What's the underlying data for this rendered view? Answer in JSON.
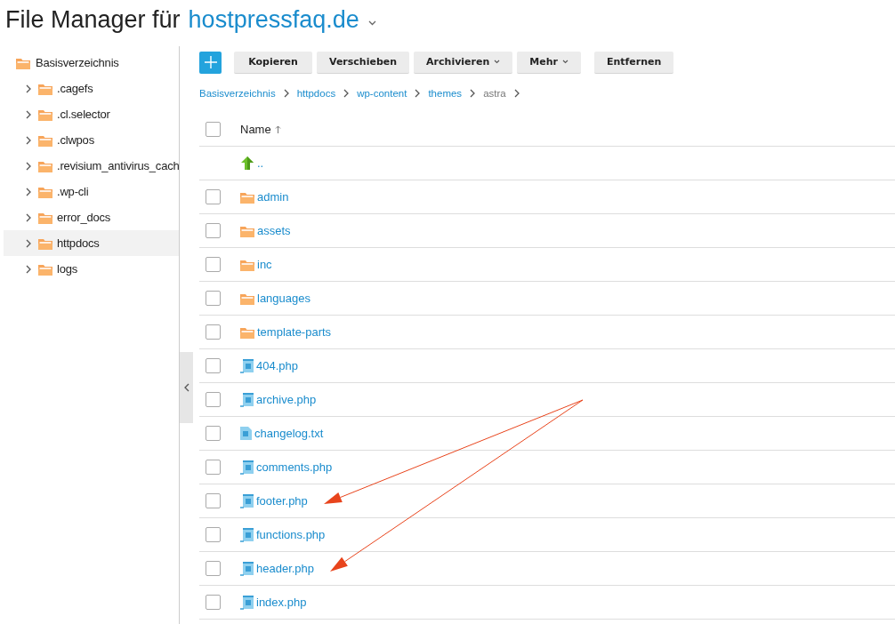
{
  "title": {
    "prefix": "File Manager für",
    "domain": "hostpressfaq.de"
  },
  "tree": {
    "name": "Basisverzeichnis",
    "children": [
      {
        "name": ".cagefs",
        "expanded": false,
        "selected": false
      },
      {
        "name": ".cl.selector",
        "expanded": false,
        "selected": false
      },
      {
        "name": ".clwpos",
        "expanded": false,
        "selected": false
      },
      {
        "name": ".revisium_antivirus_cach",
        "expanded": false,
        "selected": false
      },
      {
        "name": ".wp-cli",
        "expanded": false,
        "selected": false
      },
      {
        "name": "error_docs",
        "expanded": false,
        "selected": false
      },
      {
        "name": "httpdocs",
        "expanded": false,
        "selected": true
      },
      {
        "name": "logs",
        "expanded": false,
        "selected": false
      }
    ]
  },
  "toolbar": {
    "buttons": [
      {
        "label": "Kopieren",
        "has_menu": false
      },
      {
        "label": "Verschieben",
        "has_menu": false
      },
      {
        "label": "Archivieren",
        "has_menu": true
      },
      {
        "label": "Mehr",
        "has_menu": true
      },
      {
        "label": "Entfernen",
        "has_menu": false
      }
    ]
  },
  "breadcrumb": [
    {
      "label": "Basisverzeichnis",
      "current": false
    },
    {
      "label": "httpdocs",
      "current": false
    },
    {
      "label": "wp-content",
      "current": false
    },
    {
      "label": "themes",
      "current": false
    },
    {
      "label": "astra",
      "current": true
    }
  ],
  "table": {
    "columns": [
      {
        "label": "Name",
        "sort_ascending": true
      }
    ],
    "select_all_checked": false,
    "rows": [
      {
        "kind": "parent",
        "name": ".."
      },
      {
        "kind": "folder",
        "name": "admin",
        "checked": false
      },
      {
        "kind": "folder",
        "name": "assets",
        "checked": false
      },
      {
        "kind": "folder",
        "name": "inc",
        "checked": false
      },
      {
        "kind": "folder",
        "name": "languages",
        "checked": false
      },
      {
        "kind": "folder",
        "name": "template-parts",
        "checked": false
      },
      {
        "kind": "php",
        "name": "404.php",
        "checked": false
      },
      {
        "kind": "php",
        "name": "archive.php",
        "checked": false
      },
      {
        "kind": "text",
        "name": "changelog.txt",
        "checked": false
      },
      {
        "kind": "php",
        "name": "comments.php",
        "checked": false
      },
      {
        "kind": "php",
        "name": "footer.php",
        "checked": false,
        "annotated": true
      },
      {
        "kind": "php",
        "name": "functions.php",
        "checked": false
      },
      {
        "kind": "php",
        "name": "header.php",
        "checked": false,
        "annotated": true
      },
      {
        "kind": "php",
        "name": "index.php",
        "checked": false
      }
    ]
  }
}
